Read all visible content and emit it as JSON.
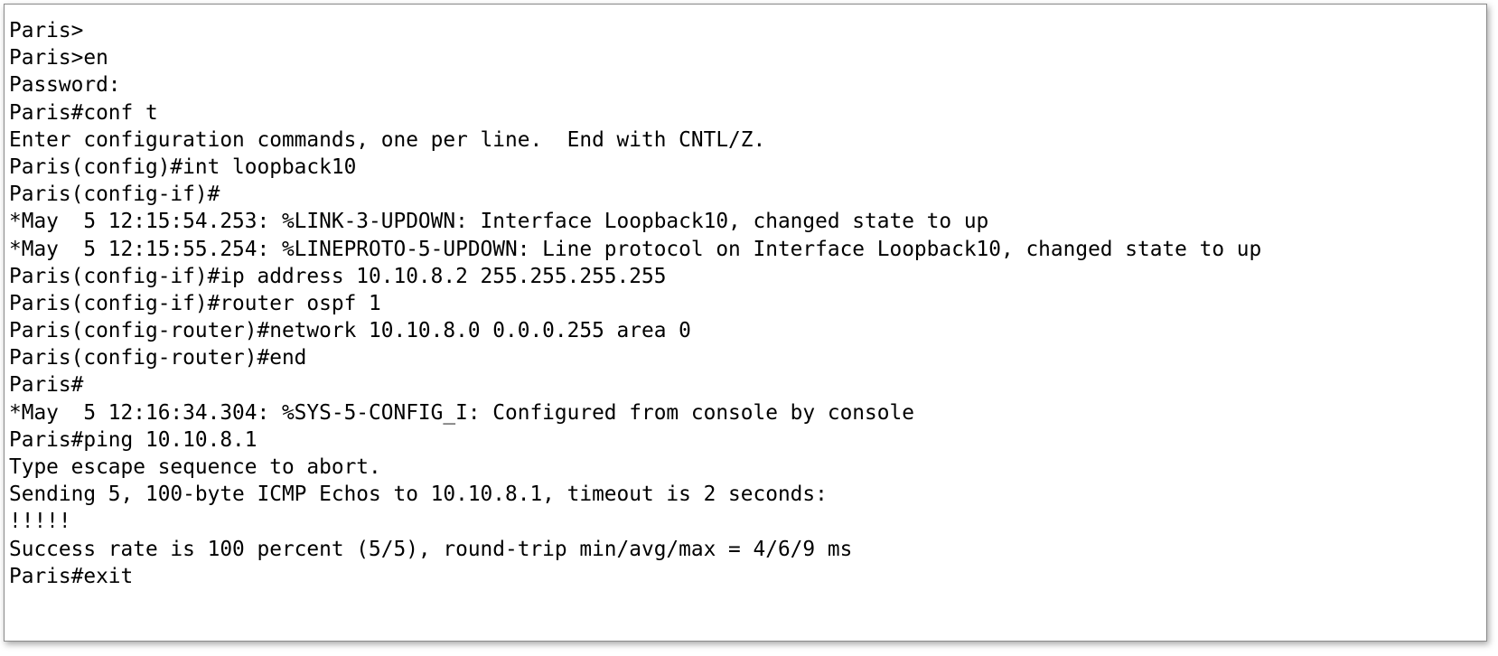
{
  "terminal": {
    "lines": [
      "Paris>",
      "Paris>en",
      "Password:",
      "Paris#conf t",
      "Enter configuration commands, one per line.  End with CNTL/Z.",
      "Paris(config)#int loopback10",
      "Paris(config-if)#",
      "*May  5 12:15:54.253: %LINK-3-UPDOWN: Interface Loopback10, changed state to up",
      "*May  5 12:15:55.254: %LINEPROTO-5-UPDOWN: Line protocol on Interface Loopback10, changed state to up",
      "Paris(config-if)#ip address 10.10.8.2 255.255.255.255",
      "Paris(config-if)#router ospf 1",
      "Paris(config-router)#network 10.10.8.0 0.0.0.255 area 0",
      "Paris(config-router)#end",
      "Paris#",
      "*May  5 12:16:34.304: %SYS-5-CONFIG_I: Configured from console by console",
      "Paris#ping 10.10.8.1",
      "Type escape sequence to abort.",
      "Sending 5, 100-byte ICMP Echos to 10.10.8.1, timeout is 2 seconds:",
      "!!!!!",
      "Success rate is 100 percent (5/5), round-trip min/avg/max = 4/6/9 ms",
      "Paris#exit"
    ]
  },
  "colors": {
    "background": "#ffffff",
    "text": "#000000",
    "border": "#8a8a8a"
  }
}
